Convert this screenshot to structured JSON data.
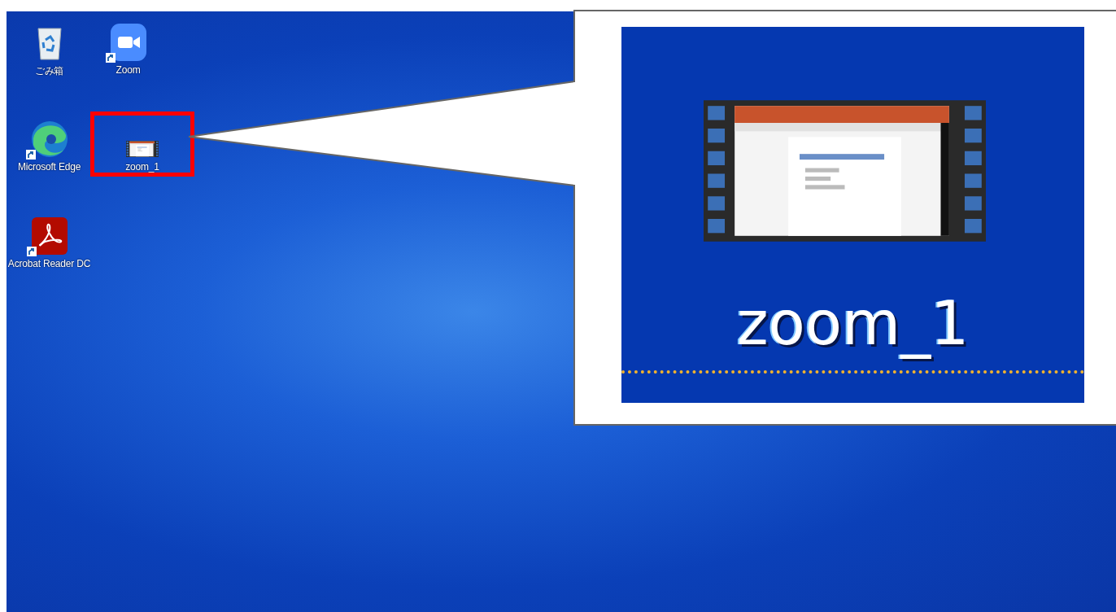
{
  "desktop_icons": [
    {
      "label": "ごみ箱",
      "kind": "recycle-bin",
      "shortcut": false,
      "selected": false
    },
    {
      "label": "Microsoft Edge",
      "kind": "browser",
      "shortcut": true,
      "selected": false
    },
    {
      "label": "Acrobat Reader DC",
      "kind": "pdf-reader",
      "shortcut": true,
      "selected": false
    },
    {
      "label": "Zoom",
      "kind": "video-app",
      "shortcut": true,
      "selected": false
    },
    {
      "label": "zoom_1",
      "kind": "video-file",
      "shortcut": false,
      "selected": true
    }
  ],
  "callout": {
    "label": "zoom_1",
    "kind": "video-file"
  }
}
